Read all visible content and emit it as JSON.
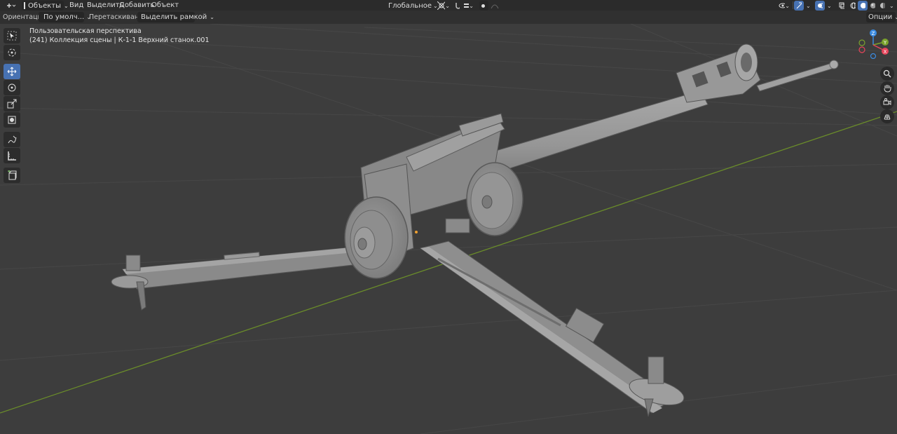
{
  "header": {
    "mode_label": "Объекты",
    "menus": [
      "Вид",
      "Выделить",
      "Добавить",
      "Объект"
    ],
    "transform_orientation": "Глобальное"
  },
  "toolbar": {
    "orientation_label": "Ориентация:",
    "orientation_value": "По умолч...",
    "drag_label": "Перетаскивание:",
    "drag_value": "Выделить рамкой",
    "options_label": "Опции"
  },
  "viewport": {
    "view_name": "Пользовательская перспектива",
    "collection_info": "(241) Коллекция сцены | К-1-1 Верхний станок.001"
  },
  "gizmo": {
    "z": "Z",
    "y": "Y",
    "x": "X"
  },
  "colors": {
    "viewport_bg": "#3d3d3d",
    "header_bg": "#2b2b2b",
    "active_tool": "#4772b3",
    "axis_x": "#e8445a",
    "axis_y": "#7ba32c",
    "axis_z": "#3a8be0"
  },
  "tools": [
    "select-box-icon",
    "cursor-icon",
    "move-icon",
    "rotate-icon",
    "scale-icon",
    "transform-icon",
    "annotate-icon",
    "measure-icon",
    "add-cube-icon"
  ],
  "nav": [
    "zoom-icon",
    "hand-pan-icon",
    "camera-icon",
    "grid-view-icon"
  ]
}
